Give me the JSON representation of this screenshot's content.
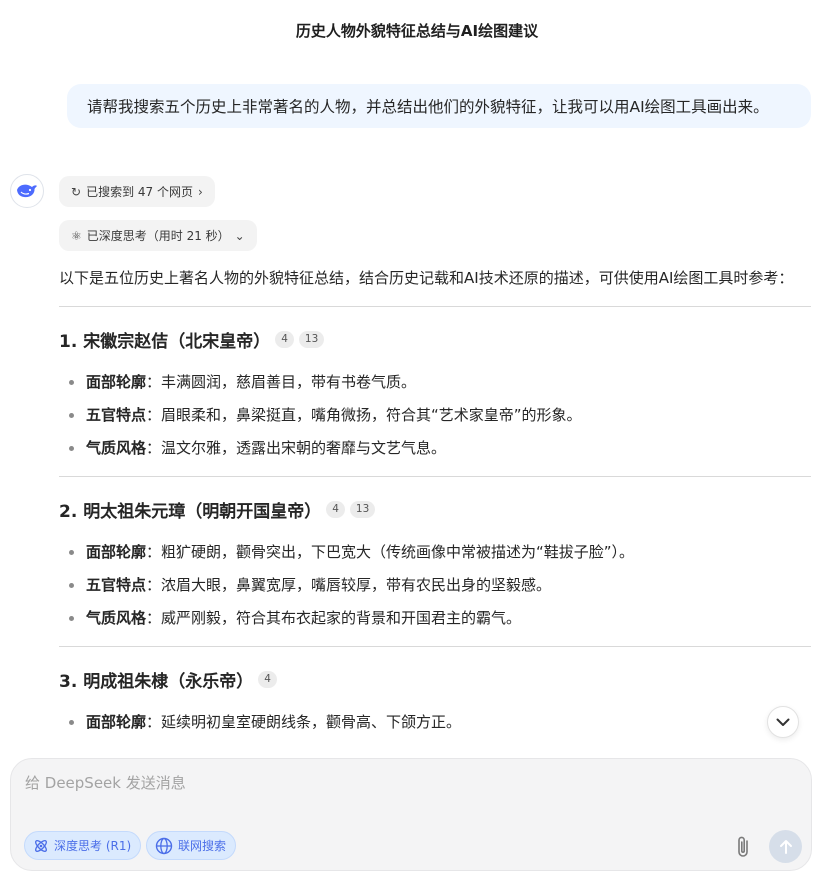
{
  "header": {
    "title": "历史人物外貌特征总结与AI绘图建议"
  },
  "user_message": "请帮我搜索五个历史上非常著名的人物，并总结出他们的外貌特征，让我可以用AI绘图工具画出来。",
  "assistant": {
    "avatar_icon": "deepseek-whale-icon",
    "search_pill": "已搜索到 47 个网页",
    "think_pill": "已深度思考（用时 21 秒）",
    "intro": "以下是五位历史上著名人物的外貌特征总结，结合历史记载和AI技术还原的描述，可供使用AI绘图工具时参考：",
    "sections": [
      {
        "title": "1. 宋徽宗赵佶（北宋皇帝）",
        "badges": [
          "4",
          "13"
        ],
        "points": [
          {
            "label": "面部轮廓",
            "text": "：丰满圆润，慈眉善目，带有书卷气质。"
          },
          {
            "label": "五官特点",
            "text": "：眉眼柔和，鼻梁挺直，嘴角微扬，符合其“艺术家皇帝”的形象。"
          },
          {
            "label": "气质风格",
            "text": "：温文尔雅，透露出宋朝的奢靡与文艺气息。"
          }
        ]
      },
      {
        "title": "2. 明太祖朱元璋（明朝开国皇帝）",
        "badges": [
          "4",
          "13"
        ],
        "points": [
          {
            "label": "面部轮廓",
            "text": "：粗犷硬朗，颧骨突出，下巴宽大（传统画像中常被描述为“鞋拔子脸”）。"
          },
          {
            "label": "五官特点",
            "text": "：浓眉大眼，鼻翼宽厚，嘴唇较厚，带有农民出身的坚毅感。"
          },
          {
            "label": "气质风格",
            "text": "：威严刚毅，符合其布衣起家的背景和开国君主的霸气。"
          }
        ]
      },
      {
        "title": "3. 明成祖朱棣（永乐帝）",
        "badges": [
          "4"
        ],
        "points": [
          {
            "label": "面部轮廓",
            "text": "：延续明初皇室硬朗线条，颧骨高、下颌方正。"
          }
        ]
      }
    ]
  },
  "composer": {
    "placeholder": "给 DeepSeek 发送消息",
    "deep_think_label": "深度思考 (R1)",
    "web_search_label": "联网搜索"
  },
  "colors": {
    "accent": "#4b6ee8",
    "bubble": "#eff6ff",
    "pill_bg": "#f3f3f3"
  }
}
